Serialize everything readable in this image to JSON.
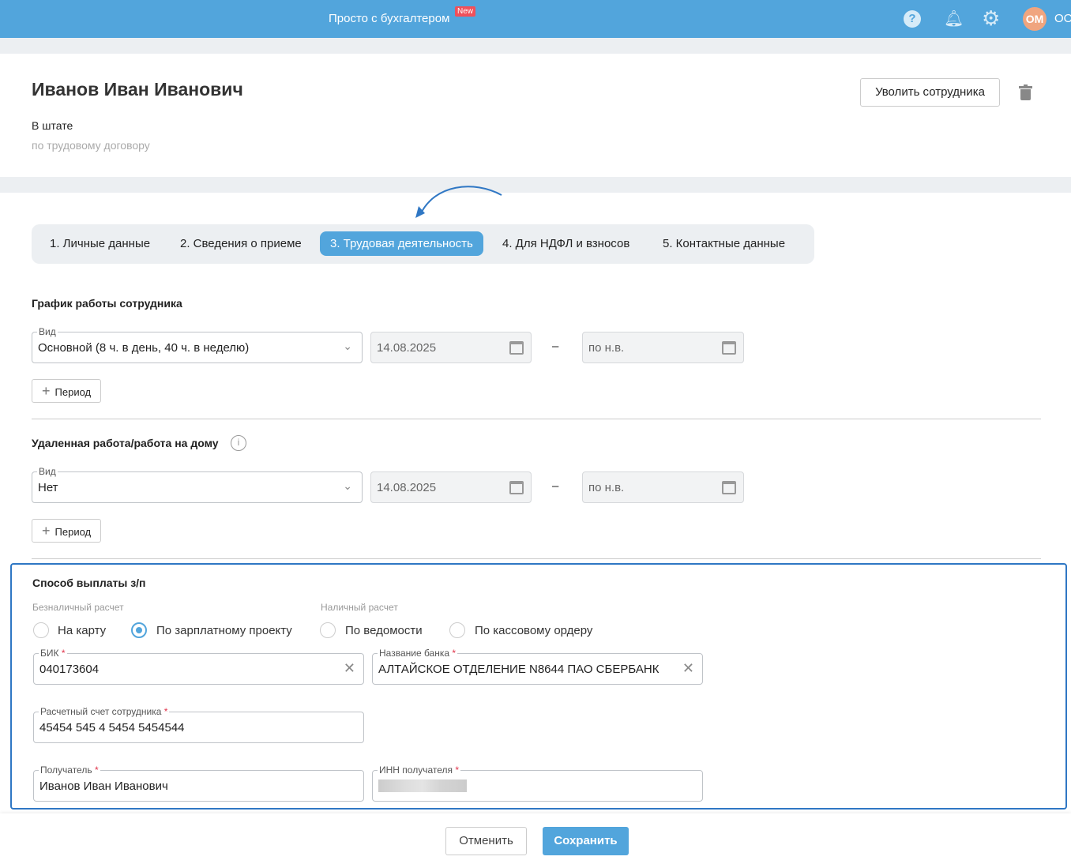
{
  "header": {
    "brand": "Просто с бухгалтером",
    "badge": "New",
    "avatar": "ОМ",
    "user": "ОО",
    "icons": [
      "help-icon",
      "bell-icon",
      "gear-icon"
    ]
  },
  "employee": {
    "name": "Иванов Иван Иванович",
    "status": "В штате",
    "contract": "по трудовому договору",
    "dismiss_label": "Уволить сотрудника"
  },
  "tabs": [
    "1. Личные данные",
    "2. Сведения о приеме",
    "3. Трудовая деятельность",
    "4. Для НДФЛ и взносов",
    "5. Контактные данные"
  ],
  "schedule": {
    "title": "График работы сотрудника",
    "type_label": "Вид",
    "type_value": "Основной (8 ч. в день, 40 ч. в неделю)",
    "from": "14.08.2025",
    "dash": "–",
    "to": "по н.в.",
    "add_period": "Период"
  },
  "remote": {
    "title": "Удаленная работа/работа на дому",
    "type_label": "Вид",
    "type_value": "Нет",
    "from": "14.08.2025",
    "dash": "–",
    "to": "по н.в.",
    "add_period": "Период"
  },
  "payment": {
    "title": "Способ выплаты з/п",
    "cashless": "Безналичный расчет",
    "cash": "Наличный расчет",
    "options": [
      "На карту",
      "По зарплатному проекту",
      "По ведомости",
      "По кассовому ордеру"
    ],
    "selected": 1,
    "bik_label": "БИК",
    "bik": "040173604",
    "bank_label": "Название банка",
    "bank": "АЛТАЙСКОЕ ОТДЕЛЕНИЕ N8644 ПАО СБЕРБАНК",
    "account_label": "Расчетный счет сотрудника",
    "account": "45454 545 4 5454 5454544",
    "recipient_label": "Получатель",
    "recipient": "Иванов Иван Иванович",
    "inn_label": "ИНН получателя"
  },
  "footer": {
    "cancel": "Отменить",
    "save": "Сохранить"
  },
  "colors": {
    "primary": "#52a5dc",
    "highlight": "#2f77c4"
  }
}
